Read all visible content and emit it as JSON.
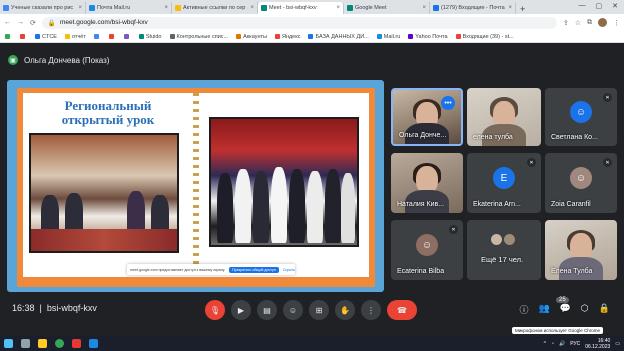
{
  "browser": {
    "tabs": [
      {
        "label": "Ученые сказали про рис",
        "color": "#4285f4",
        "active": false
      },
      {
        "label": "Почта Mail.ru",
        "color": "#168de2",
        "active": false
      },
      {
        "label": "Активные ссылки по сер",
        "color": "#fbbc05",
        "active": false
      },
      {
        "label": "Meet - bsi-wbqf-kxv",
        "color": "#00897b",
        "active": true
      },
      {
        "label": "Google Meet",
        "color": "#00897b",
        "active": false
      },
      {
        "label": "(1279) Входящие - Почта",
        "color": "#1a73e8",
        "active": false
      }
    ],
    "new_tab": "+",
    "url": "meet.google.com/bsi-wbqf-kxv",
    "bookmarks": [
      {
        "label": "",
        "color": "#34a853"
      },
      {
        "label": "",
        "color": "#ea4335"
      },
      {
        "label": "CTCE",
        "color": "#1a73e8"
      },
      {
        "label": "отчёт",
        "color": "#fbbc05"
      },
      {
        "label": "",
        "color": "#4285f4"
      },
      {
        "label": "",
        "color": "#ea4335"
      },
      {
        "label": "",
        "color": "#7e57c2"
      },
      {
        "label": "Stuido",
        "color": "#00897b"
      },
      {
        "label": "Контрольные спис...",
        "color": "#5f6368"
      },
      {
        "label": "Аккаунты",
        "color": "#e37400"
      },
      {
        "label": "Яндекс",
        "color": "#ea4335"
      },
      {
        "label": "БАЗА ДАННЫХ ДИ...",
        "color": "#1a73e8"
      },
      {
        "label": "Mail.ru",
        "color": "#168de2"
      },
      {
        "label": "Yahoo Почта",
        "color": "#6001d2"
      },
      {
        "label": "Входящие (39) - st...",
        "color": "#ea4335"
      }
    ]
  },
  "meet": {
    "presenter_label": "Ольга Дончева (Показ)",
    "slide": {
      "title_line1": "Региональный",
      "title_line2": "открытый урок"
    },
    "share_banner": {
      "text": "meet.google.com предоставляет доступ к вашему экрану.",
      "stop_button": "Прекратить общий доступ",
      "hide_button": "Скрыть"
    },
    "participants": [
      {
        "name": "Ольга Донче...",
        "type": "video"
      },
      {
        "name": "елена тулба",
        "type": "video"
      },
      {
        "name": "Светлана Ко...",
        "type": "avatar",
        "avatar_color": "#1a73e8",
        "initial": ""
      },
      {
        "name": "Наталия Кив...",
        "type": "video"
      },
      {
        "name": "Ekaterina Arn...",
        "type": "avatar",
        "avatar_color": "#1a73e8",
        "initial": "E"
      },
      {
        "name": "Zoia Caranfil",
        "type": "avatar",
        "avatar_color": "#a1887f",
        "initial": ""
      },
      {
        "name": "Ecaterina Bilba",
        "type": "avatar",
        "avatar_color": "#8d6e63",
        "initial": ""
      },
      {
        "name": "Ещё 17 чел.",
        "type": "more"
      },
      {
        "name": "Елена Тулба",
        "type": "video"
      }
    ],
    "meeting_time": "16:38",
    "meeting_code": "bsi-wbqf-kxv",
    "participants_count": "25",
    "mic_tooltip": "Микрофоном использует Google Chrome"
  },
  "taskbar": {
    "time": "16:40",
    "date": "06.12.2023",
    "lang": "РУС"
  }
}
